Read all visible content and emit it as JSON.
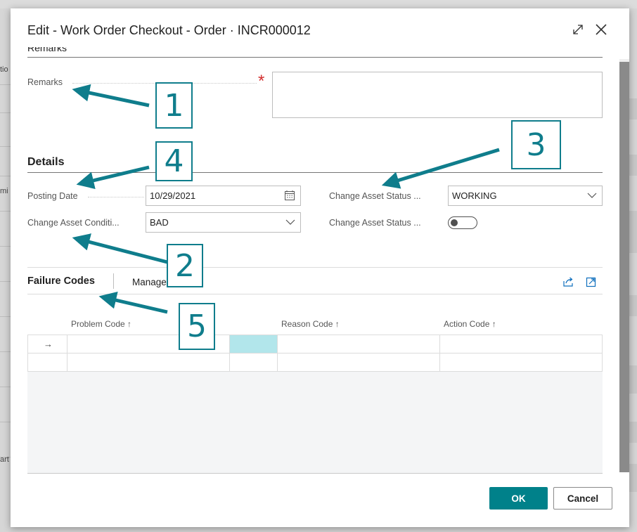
{
  "dialog": {
    "title": "Edit - Work Order Checkout - Order · INCR000012",
    "expand_icon": "expand-icon",
    "close_icon": "close-icon"
  },
  "remarks_section": {
    "label": "Remarks",
    "field_label": "Remarks",
    "value": "",
    "required": "*"
  },
  "details": {
    "title": "Details",
    "posting_date": {
      "label": "Posting Date",
      "value": "10/29/2021",
      "icon": "calendar-icon"
    },
    "change_asset_condition": {
      "label": "Change Asset Conditi...",
      "value": "BAD",
      "icon": "chevron-down-icon"
    },
    "change_asset_status_select": {
      "label": "Change Asset Status ...",
      "value": "WORKING",
      "icon": "chevron-down-icon"
    },
    "change_asset_status_toggle": {
      "label": "Change Asset Status ...",
      "on": false
    }
  },
  "failure_codes": {
    "title": "Failure Codes",
    "manage": "Manage",
    "share_icon": "share-icon",
    "open_icon": "open-in-new-icon",
    "columns": [
      "Problem Code ↑",
      "Reason Code ↑",
      "Action Code ↑"
    ],
    "row_indicator": "→"
  },
  "buttons": {
    "ok": "OK",
    "cancel": "Cancel"
  },
  "annotations": [
    "1",
    "2",
    "3",
    "4",
    "5"
  ],
  "background": {
    "left_fragments": [
      "tio",
      "mi",
      "art"
    ]
  },
  "colors": {
    "accent": "#00818a",
    "annotation": "#0f7d8c",
    "required": "#d32f2f",
    "highlight_cell": "#b2e6eb"
  }
}
